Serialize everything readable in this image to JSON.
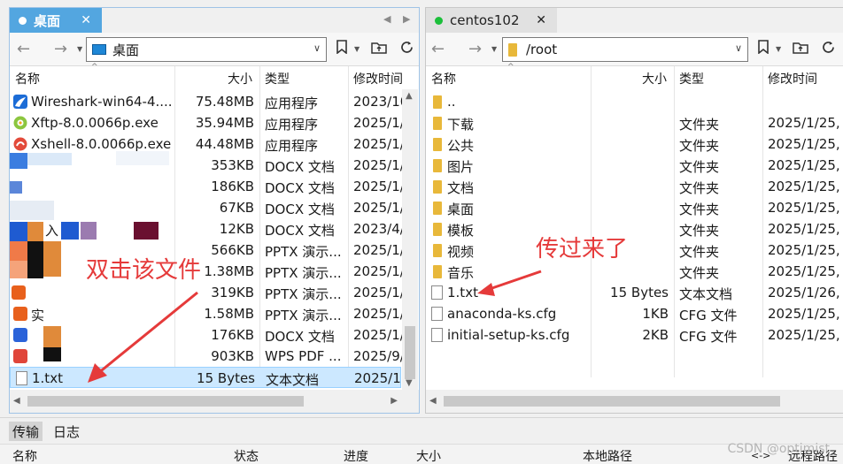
{
  "left_pane": {
    "tab": {
      "title": "桌面",
      "close": "✕"
    },
    "tab_nav": {
      "prev": "◀",
      "next": "▶"
    },
    "address": "桌面",
    "columns": {
      "name": "名称",
      "size": "大小",
      "type": "类型",
      "modified": "修改时间"
    },
    "rows": [
      {
        "name": "Wireshark-win64-4....",
        "size": "75.48MB",
        "type": "应用程序",
        "modified": "2023/10"
      },
      {
        "name": "Xftp-8.0.0066p.exe",
        "size": "35.94MB",
        "type": "应用程序",
        "modified": "2025/1/"
      },
      {
        "name": "Xshell-8.0.0066p.exe",
        "size": "44.48MB",
        "type": "应用程序",
        "modified": "2025/1/"
      },
      {
        "name": "",
        "size": "353KB",
        "type": "DOCX 文档",
        "modified": "2025/1/"
      },
      {
        "name": "",
        "size": "186KB",
        "type": "DOCX 文档",
        "modified": "2025/1/"
      },
      {
        "name": "",
        "size": "67KB",
        "type": "DOCX 文档",
        "modified": "2025/1/"
      },
      {
        "name": "入",
        "size": "12KB",
        "type": "DOCX 文档",
        "modified": "2023/4/"
      },
      {
        "name": "",
        "size": "566KB",
        "type": "PPTX 演示...",
        "modified": "2025/1/"
      },
      {
        "name": "",
        "size": "1.38MB",
        "type": "PPTX 演示...",
        "modified": "2025/1/"
      },
      {
        "name": "",
        "size": "319KB",
        "type": "PPTX 演示...",
        "modified": "2025/1/"
      },
      {
        "name": "实",
        "size": "1.58MB",
        "type": "PPTX 演示...",
        "modified": "2025/1/"
      },
      {
        "name": "",
        "size": "176KB",
        "type": "DOCX 文档",
        "modified": "2025/1/"
      },
      {
        "name": "",
        "size": "903KB",
        "type": "WPS PDF ...",
        "modified": "2025/9/"
      },
      {
        "name": "1.txt",
        "size": "15 Bytes",
        "type": "文本文档",
        "modified": "2025/1/"
      }
    ],
    "annotation": "双击该文件"
  },
  "right_pane": {
    "tab": {
      "title": "centos102",
      "close": "✕"
    },
    "tab_nav": {
      "prev": "◀",
      "next": "▶"
    },
    "address": "/root",
    "columns": {
      "name": "名称",
      "size": "大小",
      "type": "类型",
      "modified": "修改时间"
    },
    "rows": [
      {
        "name": "..",
        "size": "",
        "type": "",
        "modified": ""
      },
      {
        "name": "下载",
        "size": "",
        "type": "文件夹",
        "modified": "2025/1/25,"
      },
      {
        "name": "公共",
        "size": "",
        "type": "文件夹",
        "modified": "2025/1/25,"
      },
      {
        "name": "图片",
        "size": "",
        "type": "文件夹",
        "modified": "2025/1/25,"
      },
      {
        "name": "文档",
        "size": "",
        "type": "文件夹",
        "modified": "2025/1/25,"
      },
      {
        "name": "桌面",
        "size": "",
        "type": "文件夹",
        "modified": "2025/1/25,"
      },
      {
        "name": "模板",
        "size": "",
        "type": "文件夹",
        "modified": "2025/1/25,"
      },
      {
        "name": "视频",
        "size": "",
        "type": "文件夹",
        "modified": "2025/1/25,"
      },
      {
        "name": "音乐",
        "size": "",
        "type": "文件夹",
        "modified": "2025/1/25,"
      },
      {
        "name": "1.txt",
        "size": "15 Bytes",
        "type": "文本文档",
        "modified": "2025/1/26,"
      },
      {
        "name": "anaconda-ks.cfg",
        "size": "1KB",
        "type": "CFG 文件",
        "modified": "2025/1/25,"
      },
      {
        "name": "initial-setup-ks.cfg",
        "size": "2KB",
        "type": "CFG 文件",
        "modified": "2025/1/25,"
      }
    ],
    "annotation": "传过来了"
  },
  "nav": {
    "back": "←",
    "forward": "→",
    "dropdown": "▼",
    "chevron": "∨"
  },
  "toolbar_icons": [
    "bookmark-icon",
    "folder-up-icon",
    "refresh-icon"
  ],
  "bottom": {
    "tabs": [
      "传输",
      "日志"
    ],
    "transfer_columns": {
      "name": "名称",
      "status": "状态",
      "progress": "进度",
      "size": "大小",
      "local_path": "本地路径",
      "arrow": "<->",
      "remote_path": "远程路径"
    }
  },
  "watermark": "CSDN @optimist_"
}
